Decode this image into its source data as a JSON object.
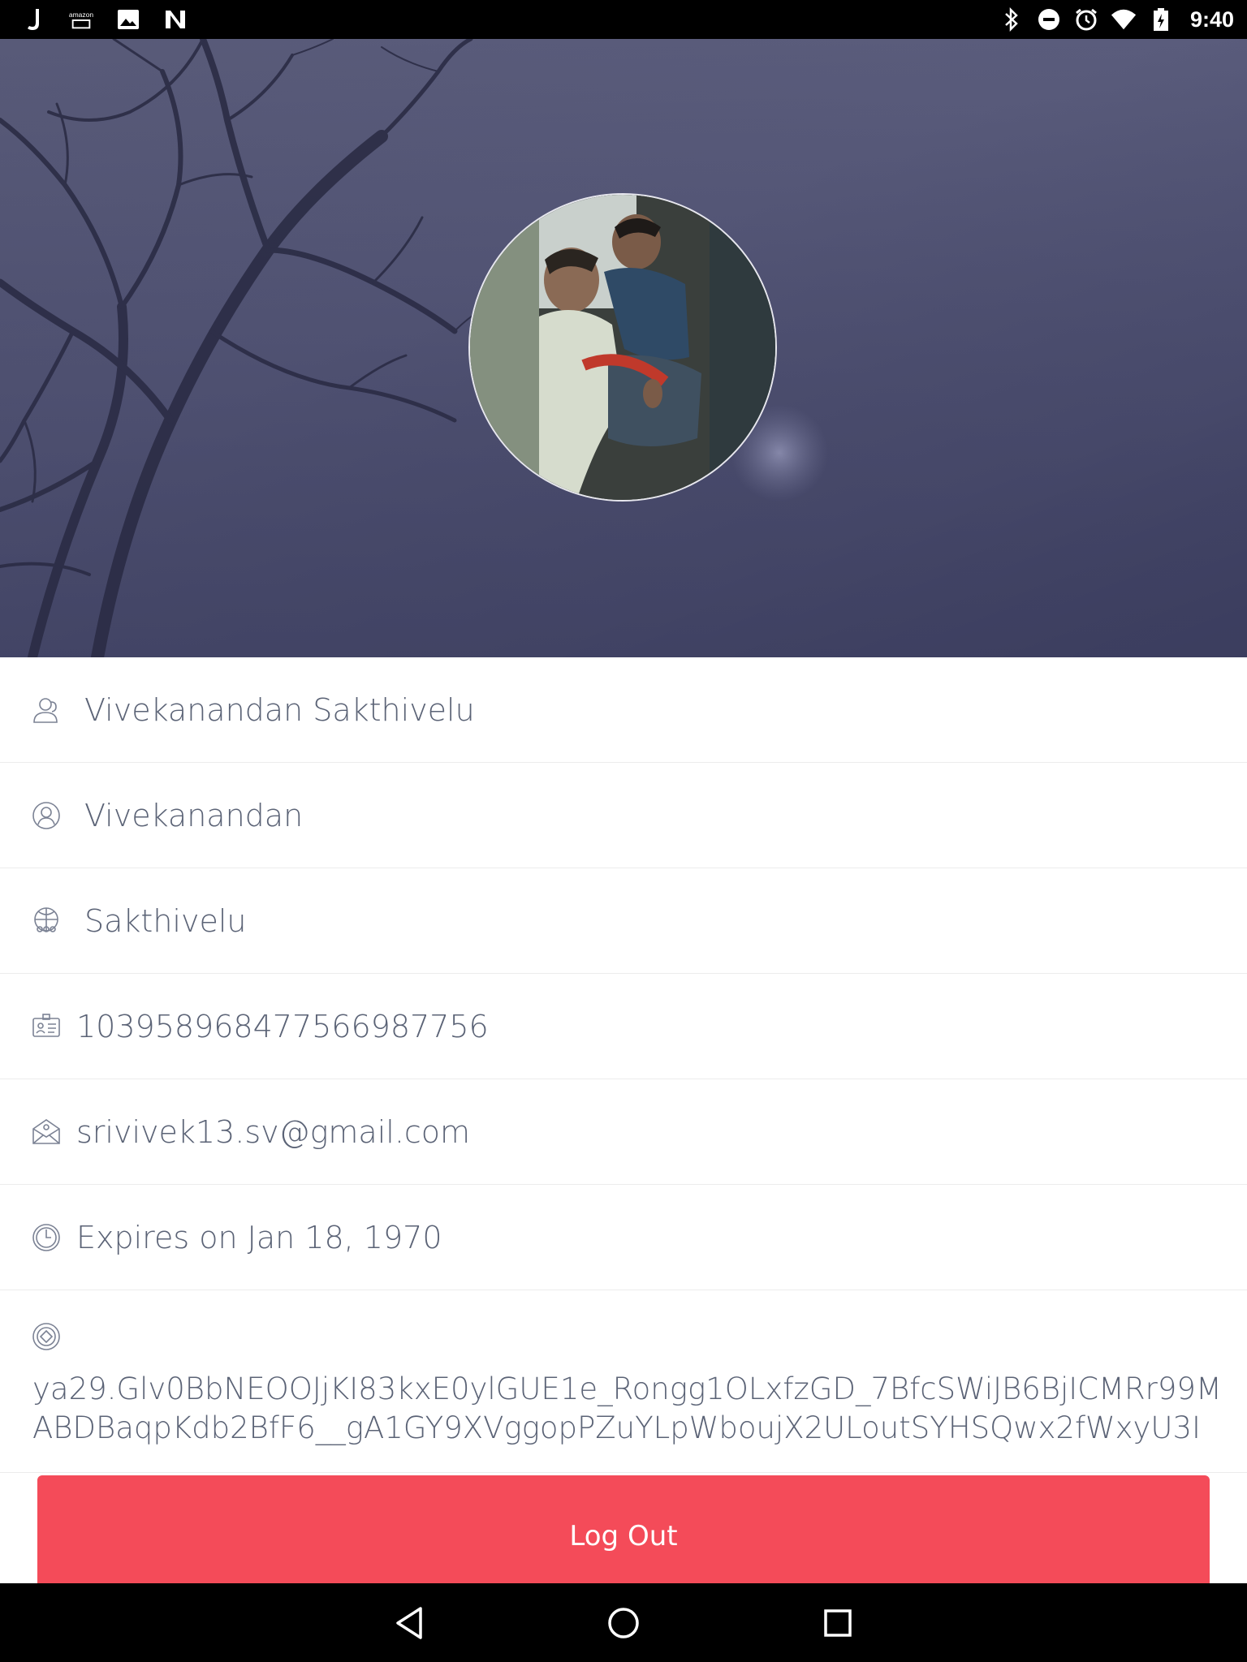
{
  "status_bar": {
    "time": "9:40",
    "left_icons": [
      "j-app-icon",
      "amazon-icon",
      "image-icon",
      "n-app-icon"
    ],
    "right_icons": [
      "bluetooth-icon",
      "do-not-disturb-icon",
      "alarm-icon",
      "wifi-icon",
      "battery-icon"
    ]
  },
  "profile": {
    "full_name": "Vivekanandan Sakthivelu",
    "first_name": "Vivekanandan",
    "last_name": "Sakthivelu",
    "user_id": "103958968477566987756",
    "email": "srivivek13.sv@gmail.com",
    "expiry": "Expires on Jan 18, 1970",
    "token": " ya29.Glv0BbNEOOJjKI83kxE0ylGUE1e_Rongg1OLxfzGD_7BfcSWiJB6BjICMRr99MABDBaqpKdb2BfF6__gA1GY9XVggopPZuYLpWboujX2ULoutSYHSQwx2fWxyU3I"
  },
  "actions": {
    "logout_label": "Log Out"
  },
  "icons": {
    "full_name": "users-icon",
    "first_name": "user-icon",
    "last_name": "globe-users-icon",
    "user_id": "id-card-icon",
    "email": "envelope-icon",
    "expiry": "clock-icon",
    "token": "token-icon"
  },
  "colors": {
    "logout_button": "#f44b59",
    "text": "#5b6376",
    "header": "#585a78"
  }
}
